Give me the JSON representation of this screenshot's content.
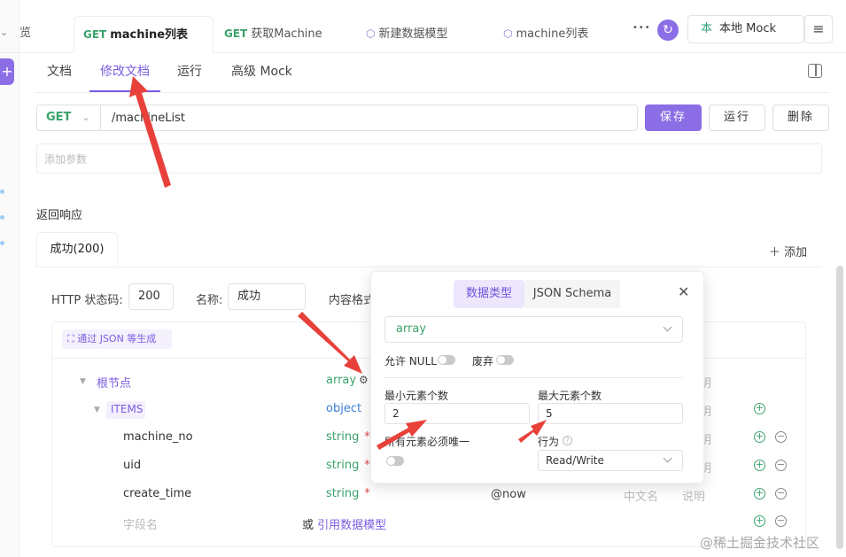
{
  "top_tabs": [
    {
      "label": "览"
    },
    {
      "method": "GET",
      "label": "machine列表"
    },
    {
      "method": "GET",
      "label": "获取Machine"
    },
    {
      "icon": "cube-icon",
      "label": "新建数据模型"
    },
    {
      "icon": "cube-icon",
      "label": "machine列表"
    }
  ],
  "more_label": "•••",
  "env": {
    "prefix": "本",
    "label": "本地 Mock"
  },
  "sub_tabs": [
    "文档",
    "修改文档",
    "运行",
    "高级 Mock"
  ],
  "request": {
    "method": "GET",
    "path": "/machineList",
    "save": "保存",
    "run": "运行",
    "delete": "删除",
    "params_placeholder": "添加参数"
  },
  "response": {
    "section_title": "返回响应",
    "tab": "成功(200)",
    "add": "添加",
    "status_label": "HTTP 状态码:",
    "status_value": "200",
    "name_label": "名称:",
    "name_value": "成功",
    "content_label": "内容格式"
  },
  "schema": {
    "gen_button": "通过 JSON 等生成",
    "rows": [
      {
        "name": "根节点",
        "type": "array",
        "extra": "",
        "cn": "",
        "desc": ""
      },
      {
        "name": "ITEMS",
        "type": "object",
        "extra": "",
        "cn": "",
        "desc": ""
      },
      {
        "name": "machine_no",
        "type": "string",
        "required": "*",
        "extra": "",
        "cn": "",
        "desc": ""
      },
      {
        "name": "uid",
        "type": "string",
        "required": "*",
        "extra": "",
        "cn": "",
        "desc": ""
      },
      {
        "name": "create_time",
        "type": "string",
        "required": "*",
        "extra": "@now",
        "cn": "中文名",
        "desc": "说明"
      }
    ],
    "new_field_placeholder": "字段名",
    "or_label": "或",
    "ref_link": "引用数据模型"
  },
  "popover": {
    "tab_data_type": "数据类型",
    "tab_json_schema": "JSON Schema",
    "type_value": "array",
    "allow_null": "允许 NULL",
    "deprecated": "废弃",
    "min_items_label": "最小元素个数",
    "min_items_value": "2",
    "max_items_label": "最大元素个数",
    "max_items_value": "5",
    "unique_label": "所有元素必须唯一",
    "behavior_label": "行为",
    "behavior_value": "Read/Write"
  },
  "watermark": "@稀土掘金技术社区",
  "colors": {
    "accent": "#8b6ee6",
    "get": "#3aa36b",
    "arrow": "#e8413a"
  }
}
